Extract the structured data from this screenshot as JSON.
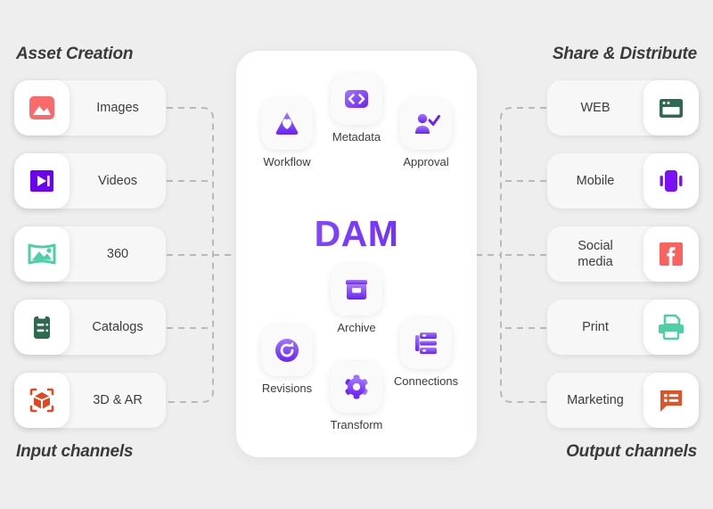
{
  "headings": {
    "asset_creation": "Asset Creation",
    "input_channels": "Input channels",
    "share_distribute": "Share & Distribute",
    "output_channels": "Output channels"
  },
  "center": {
    "wordmark": "DAM",
    "features": [
      {
        "id": "workflow",
        "label": "Workflow",
        "icon": "workflow-icon"
      },
      {
        "id": "metadata",
        "label": "Metadata",
        "icon": "code-brackets-icon"
      },
      {
        "id": "approval",
        "label": "Approval",
        "icon": "user-check-icon"
      },
      {
        "id": "archive",
        "label": "Archive",
        "icon": "archive-box-icon"
      },
      {
        "id": "revisions",
        "label": "Revisions",
        "icon": "refresh-circle-icon"
      },
      {
        "id": "transform",
        "label": "Transform",
        "icon": "gear-icon"
      },
      {
        "id": "connections",
        "label": "Connections",
        "icon": "sitemap-icon"
      }
    ]
  },
  "input_channels": [
    {
      "id": "images",
      "label": "Images",
      "icon": "image-icon",
      "color": "#f96a6a"
    },
    {
      "id": "videos",
      "label": "Videos",
      "icon": "video-play-icon",
      "color": "#6c00f5"
    },
    {
      "id": "360",
      "label": "360",
      "icon": "panorama-icon",
      "color": "#4ecfa8"
    },
    {
      "id": "catalogs",
      "label": "Catalogs",
      "icon": "clipboard-icon",
      "color": "#2d6a4f"
    },
    {
      "id": "3dar",
      "label": "3D & AR",
      "icon": "ar-cube-icon",
      "color": "#e0491f"
    }
  ],
  "output_channels": [
    {
      "id": "web",
      "label": "WEB",
      "icon": "browser-window-icon",
      "color": "#2d6a4f"
    },
    {
      "id": "mobile",
      "label": "Mobile",
      "icon": "mobile-phone-icon",
      "color": "#7b0ff5"
    },
    {
      "id": "social",
      "label": "Social media",
      "label_line1": "Social",
      "label_line2": "media",
      "icon": "facebook-icon",
      "color": "#f9625f"
    },
    {
      "id": "print",
      "label": "Print",
      "icon": "printer-icon",
      "color": "#4ecfa8"
    },
    {
      "id": "marketing",
      "label": "Marketing",
      "icon": "chat-list-icon",
      "color": "#df5326"
    }
  ],
  "colors": {
    "background": "#eeeeee",
    "card": "#f7f7f7",
    "panel": "#ffffff",
    "connector": "#b9b9b9",
    "text": "#3c3c3c",
    "brand_purple": "#7a3cff"
  }
}
